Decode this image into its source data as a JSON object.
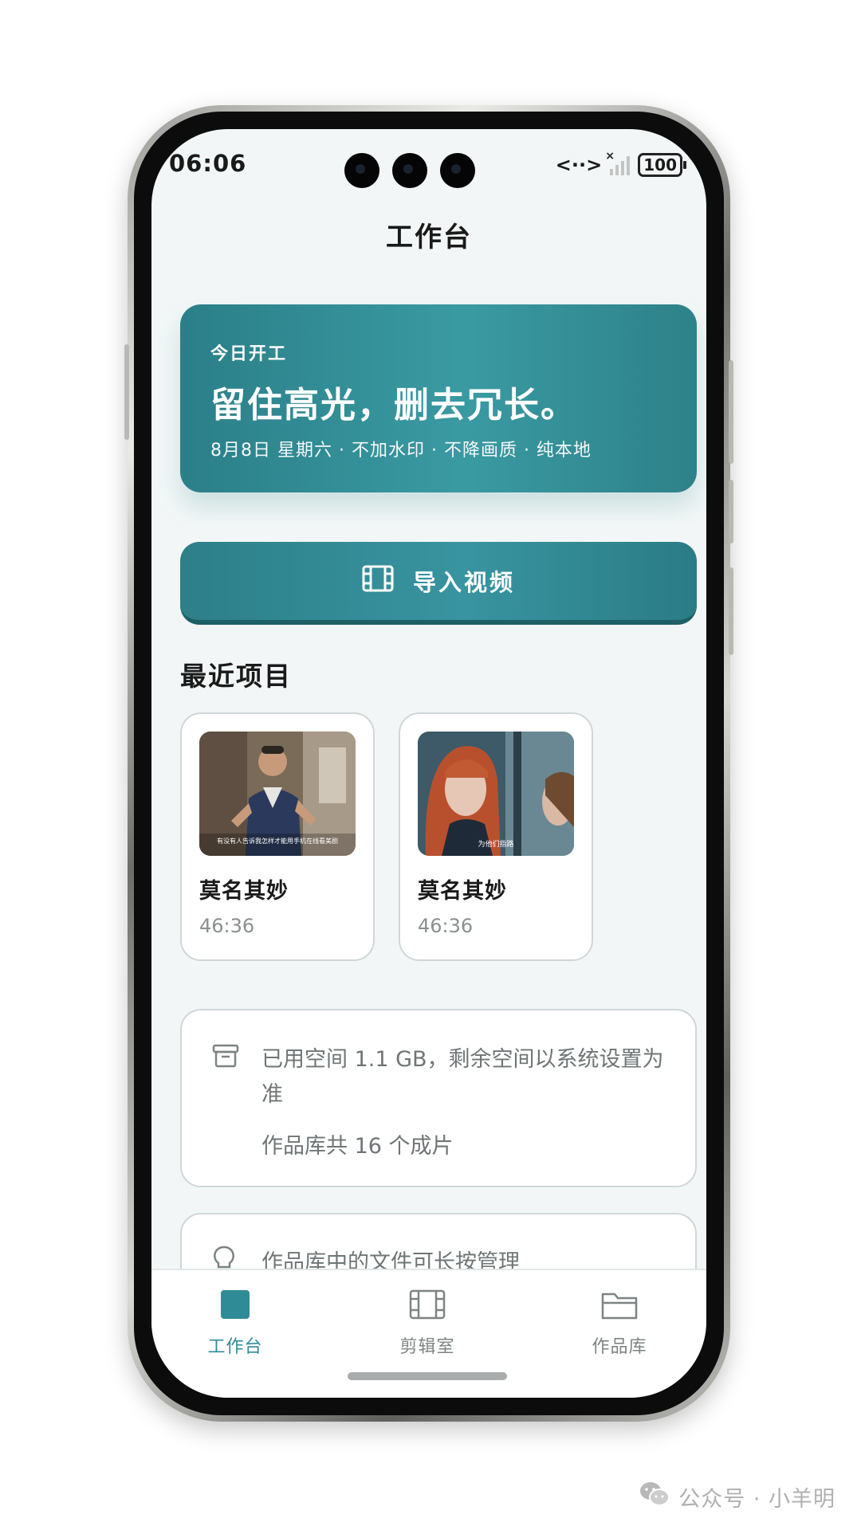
{
  "status_bar": {
    "time": "06:06",
    "battery": "100"
  },
  "header": {
    "title": "工作台"
  },
  "hero": {
    "eyebrow": "今日开工",
    "headline": "留住高光，删去冗长。",
    "subline": "8月8日 星期六 · 不加水印 · 不降画质 · 纯本地"
  },
  "import_button": {
    "label": "导入视频",
    "icon": "film-icon"
  },
  "recent": {
    "title": "最近项目",
    "items": [
      {
        "name": "莫名其妙",
        "duration": "46:36",
        "thumb_caption": "有没有人告诉我怎样才能用手机在线看美剧"
      },
      {
        "name": "莫名其妙",
        "duration": "46:36",
        "thumb_caption": "为他们指路"
      }
    ]
  },
  "storage": {
    "line1": "已用空间 1.1 GB，剩余空间以系统设置为准",
    "line2": "作品库共 16 个成片",
    "icon": "archive-icon"
  },
  "tip": {
    "text": "作品库中的文件可长按管理",
    "icon": "lightbulb-icon"
  },
  "tabs": [
    {
      "label": "工作台",
      "icon": "workbench-icon",
      "active": true
    },
    {
      "label": "剪辑室",
      "icon": "film-icon",
      "active": false
    },
    {
      "label": "作品库",
      "icon": "folder-icon",
      "active": false
    }
  ],
  "watermark": {
    "text": "公众号 · 小羊明"
  },
  "colors": {
    "accent": "#2f8b95",
    "screen_bg": "#f2f6f6",
    "muted_text": "#6f7576"
  }
}
